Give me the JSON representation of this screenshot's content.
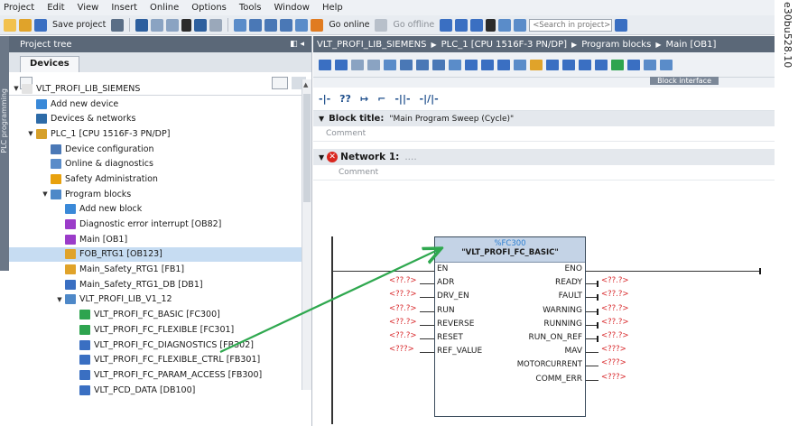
{
  "menu": [
    "Project",
    "Edit",
    "View",
    "Insert",
    "Online",
    "Options",
    "Tools",
    "Window",
    "Help"
  ],
  "toolbar": {
    "save_project": "Save project",
    "go_online": "Go online",
    "go_offline": "Go offline",
    "search_placeholder": "<Search in project>"
  },
  "left_pane": {
    "title": "Project tree",
    "collapse": "◧ ◂",
    "side_tab": "PLC programming",
    "tab": "Devices",
    "tree": [
      {
        "label": "VLT_PROFI_LIB_SIEMENS",
        "level": 0,
        "expander": "▼",
        "icon": "project-icon",
        "color": "#e3e3e3"
      },
      {
        "label": "Add new device",
        "level": 1,
        "expander": "",
        "icon": "add-device-icon",
        "color": "#3a89d8"
      },
      {
        "label": "Devices & networks",
        "level": 1,
        "expander": "",
        "icon": "network-icon",
        "color": "#2d6ba8"
      },
      {
        "label": "PLC_1 [CPU 1516F-3 PN/DP]",
        "level": 1,
        "expander": "▼",
        "icon": "plc-icon",
        "color": "#d6a02a"
      },
      {
        "label": "Device configuration",
        "level": 2,
        "expander": "",
        "icon": "device-config-icon",
        "color": "#4a78b6"
      },
      {
        "label": "Online & diagnostics",
        "level": 2,
        "expander": "",
        "icon": "diagnostics-icon",
        "color": "#5a8cc9"
      },
      {
        "label": "Safety Administration",
        "level": 2,
        "expander": "",
        "icon": "safety-icon",
        "color": "#e8a10e"
      },
      {
        "label": "Program blocks",
        "level": 2,
        "expander": "▼",
        "icon": "folder-icon",
        "color": "#4e88c8"
      },
      {
        "label": "Add new block",
        "level": 3,
        "expander": "",
        "icon": "add-block-icon",
        "color": "#3a89d8"
      },
      {
        "label": "Diagnostic error interrupt [OB82]",
        "level": 3,
        "expander": "",
        "icon": "ob-icon",
        "color": "#9b3cc9"
      },
      {
        "label": "Main [OB1]",
        "level": 3,
        "expander": "",
        "icon": "ob-icon",
        "color": "#9b3cc9"
      },
      {
        "label": "FOB_RTG1 [OB123]",
        "level": 3,
        "expander": "",
        "icon": "fob-icon",
        "color": "#e0a32a",
        "selected": true
      },
      {
        "label": "Main_Safety_RTG1 [FB1]",
        "level": 3,
        "expander": "",
        "icon": "fb-icon",
        "color": "#e0a32a"
      },
      {
        "label": "Main_Safety_RTG1_DB [DB1]",
        "level": 3,
        "expander": "",
        "icon": "db-icon",
        "color": "#3a6fc2"
      },
      {
        "label": "VLT_PROFI_LIB_V1_12",
        "level": 3,
        "expander": "▼",
        "icon": "folder-icon",
        "color": "#4e88c8"
      },
      {
        "label": "VLT_PROFI_FC_BASIC [FC300]",
        "level": 4,
        "expander": "",
        "icon": "fc-icon",
        "color": "#2ea44f"
      },
      {
        "label": "VLT_PROFI_FC_FLEXIBLE [FC301]",
        "level": 4,
        "expander": "",
        "icon": "fc-icon",
        "color": "#2ea44f"
      },
      {
        "label": "VLT_PROFI_FC_DIAGNOSTICS [FB302]",
        "level": 4,
        "expander": "",
        "icon": "fb-icon",
        "color": "#3a6fc2"
      },
      {
        "label": "VLT_PROFI_FC_FLEXIBLE_CTRL [FB301]",
        "level": 4,
        "expander": "",
        "icon": "fb-icon",
        "color": "#3a6fc2"
      },
      {
        "label": "VLT_PROFI_FC_PARAM_ACCESS [FB300]",
        "level": 4,
        "expander": "",
        "icon": "fb-icon",
        "color": "#3a6fc2"
      },
      {
        "label": "VLT_PCD_DATA [DB100]",
        "level": 4,
        "expander": "",
        "icon": "db-icon",
        "color": "#3a6fc2"
      }
    ]
  },
  "editor": {
    "breadcrumb": [
      "VLT_PROFI_LIB_SIEMENS",
      "PLC_1 [CPU 1516F-3 PN/DP]",
      "Program blocks",
      "Main [OB1]"
    ],
    "block_interface": "Block interface",
    "block_title_label": "Block title:",
    "block_title_value": "\"Main Program Sweep (Cycle)\"",
    "comment_label": "Comment",
    "network_label": "Network 1:",
    "network_dots": "....",
    "network_comment": "Comment",
    "ladder_tools": [
      "-|-",
      "??",
      "↦",
      "⌐",
      "-||-",
      "-|/|-"
    ]
  },
  "function_block": {
    "number": "%FC300",
    "name": "\"VLT_PROFI_FC_BASIC\"",
    "inputs": [
      "EN",
      "ADR",
      "DRV_EN",
      "RUN",
      "REVERSE",
      "RESET",
      "REF_VALUE"
    ],
    "outputs": [
      "ENO",
      "READY",
      "FAULT",
      "WARNING",
      "RUNNING",
      "RUN_ON_REF",
      "MAV",
      "MOTORCURRENT",
      "COMM_ERR"
    ],
    "input_args": [
      "",
      "<??.?>",
      "<??.?>",
      "<??.?>",
      "<??.?>",
      "<??.?>",
      "<???>"
    ],
    "output_args": [
      "",
      "<??.?>",
      "<??.?>",
      "<??.?>",
      "<??.?>",
      "<??.?>",
      "<???>",
      "<???>",
      "<???>"
    ]
  },
  "figure_id": "e30bu528.10",
  "colors": {
    "pane_header": "#5b6878",
    "arrow": "#2fa84f",
    "arg_text": "#d8282b",
    "fb_header": "#c4d3e6"
  }
}
